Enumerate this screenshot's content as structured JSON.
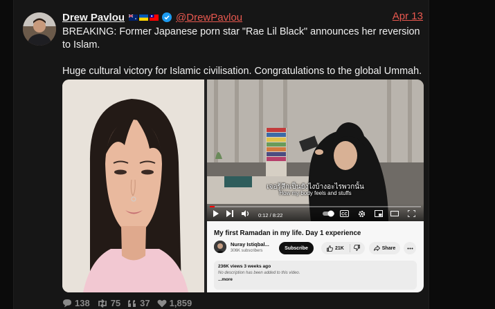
{
  "post": {
    "author": "Drew Pavlou",
    "handle": "@DrewPavlou",
    "date": "Apr 13",
    "paragraphs": [
      "BREAKING: Former Japanese porn star \"Rae Lil Black\" announces her reversion to Islam.",
      "Huge cultural victory for Islamic civilisation.  Congratulations to the global Ummah."
    ],
    "stats": {
      "replies": "138",
      "reposts": "75",
      "quotes": "37",
      "likes": "1,859"
    }
  },
  "video": {
    "subtitle_thai": "เจอรู้สึกเป็นยังไงบ้างอะไรพวกนั้น",
    "subtitle_en": "How my body feels and stuffs",
    "time": "0:12 / 8:22",
    "progress": 0.024,
    "title": "My first Ramadan in my life. Day 1 experience",
    "channel": "Nuray Istiqbal...",
    "subscribers": "306K subscribers",
    "subscribe_label": "Subscribe",
    "likes": "21K",
    "share_label": "Share",
    "views_meta": "236K views  3 weeks ago",
    "description": "No description has been added to this video.",
    "more_label": "...more"
  },
  "colors": {
    "link": "#e8584f",
    "card_bg": "#161616",
    "verified": "#1d9bf0"
  }
}
